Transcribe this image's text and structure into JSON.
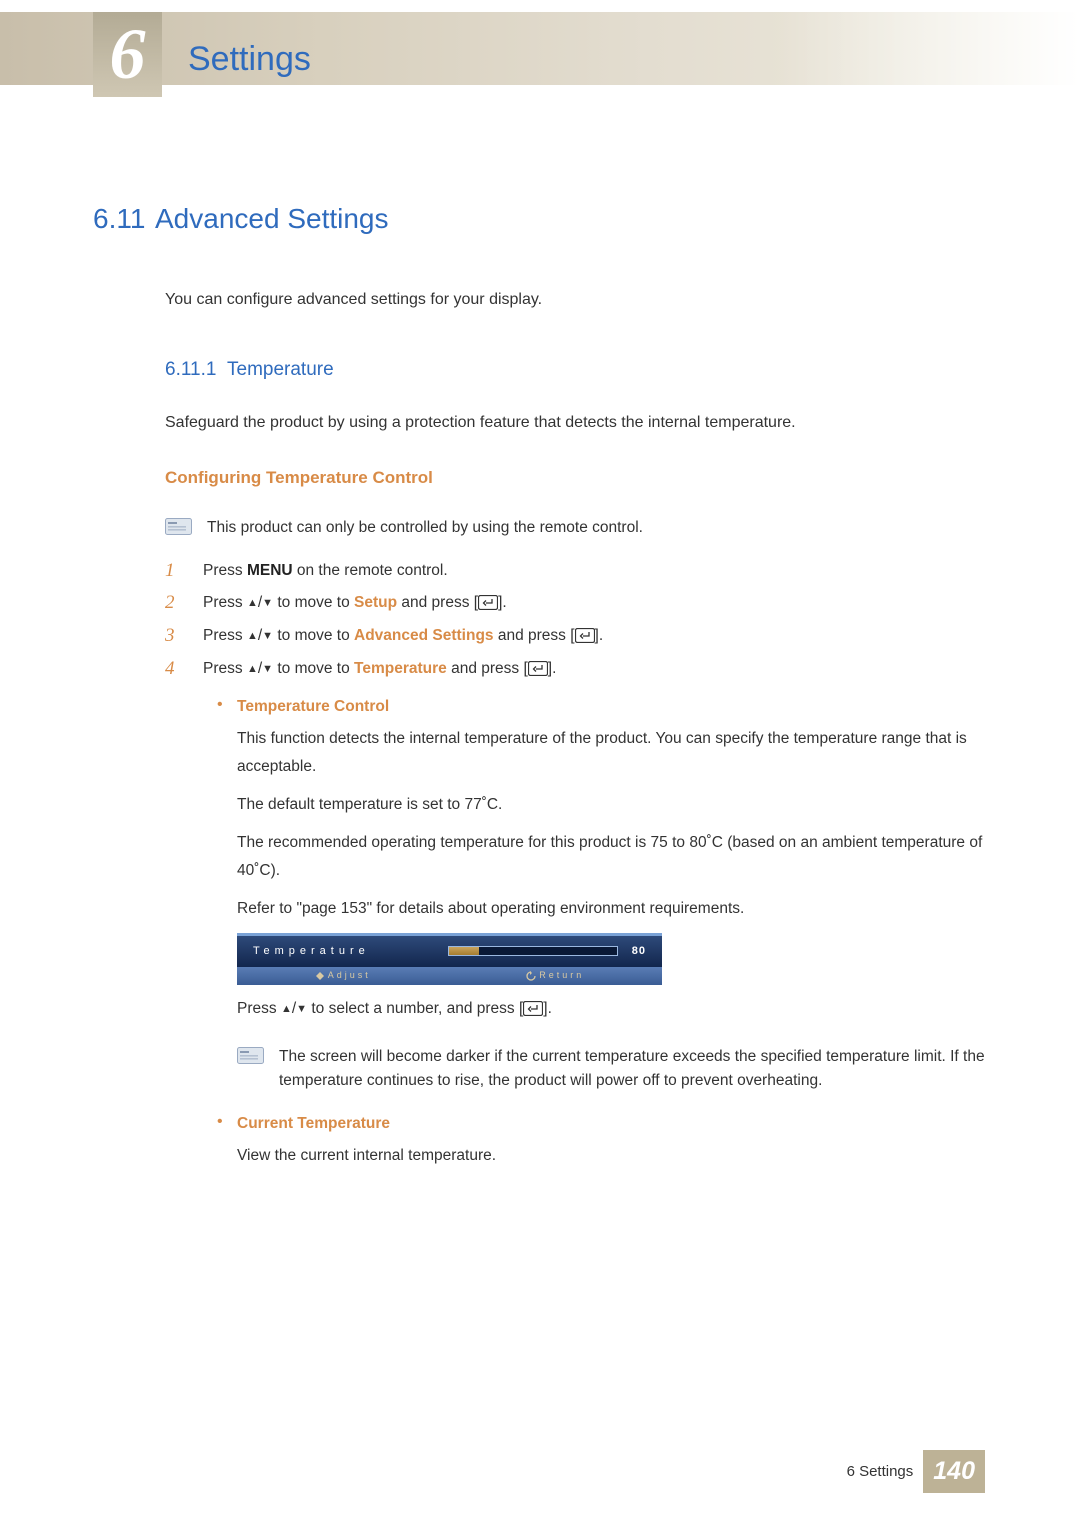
{
  "chapter": {
    "number": "6",
    "title": "Settings"
  },
  "section": {
    "number": "6.11",
    "title": "Advanced Settings",
    "intro": "You can configure advanced settings for your display."
  },
  "subsection": {
    "number": "6.11.1",
    "title": "Temperature",
    "intro": "Safeguard the product by using a protection feature that detects the internal temperature."
  },
  "config_heading": "Configuring Temperature Control",
  "note_remote": "This product can only be controlled by using the remote control.",
  "steps": {
    "s1": {
      "num": "1",
      "pre": "Press ",
      "bold": "MENU",
      "post": " on the remote control."
    },
    "s2": {
      "num": "2",
      "pre": "Press ",
      "target": "Setup",
      "mid": " to move to ",
      "post": " and press [",
      "end": "]."
    },
    "s3": {
      "num": "3",
      "pre": "Press ",
      "target": "Advanced Settings",
      "mid": " to move to ",
      "post": " and press [",
      "end": "]."
    },
    "s4": {
      "num": "4",
      "pre": "Press ",
      "target": "Temperature",
      "mid": " to move to ",
      "post": " and press [",
      "end": "]."
    }
  },
  "temp_ctrl": {
    "heading": "Temperature Control",
    "p1": "This function detects the internal temperature of the product. You can specify the temperature range that is acceptable.",
    "p2": "The default temperature is set to 77˚C.",
    "p3": "The recommended operating temperature for this product is 75 to 80˚C (based on an ambient temperature of 40˚C).",
    "p4": "Refer to \"page 153\" for details about operating environment requirements.",
    "select_line_pre": "Press ",
    "select_line_mid": " to select a number, and press [",
    "select_line_end": "]."
  },
  "osd": {
    "label": "Temperature",
    "value": "80",
    "fill_percent": 18,
    "adjust": "Adjust",
    "return": "Return"
  },
  "note_darker": "The screen will become darker if the current temperature exceeds the specified temperature limit. If the temperature continues to rise, the product will power off to prevent overheating.",
  "cur_temp": {
    "heading": "Current Temperature",
    "body": "View the current internal temperature."
  },
  "footer": {
    "chapter_ref": "6 Settings",
    "page": "140"
  },
  "glyphs": {
    "up": "▲",
    "down": "▼",
    "sep": "/"
  }
}
